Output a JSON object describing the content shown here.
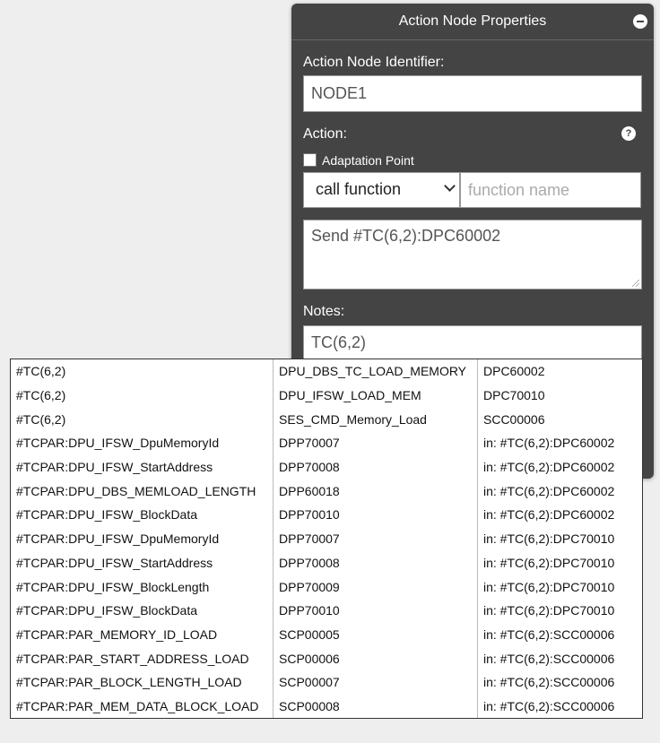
{
  "panel": {
    "title": "Action Node Properties",
    "identifier_label": "Action Node Identifier:",
    "identifier_value": "NODE1",
    "action_label": "Action:",
    "help_icon": "?",
    "adaptation_label": "Adaptation Point",
    "adaptation_checked": false,
    "select_value": "call function",
    "function_placeholder": "function name",
    "action_text": "Send #TC(6,2):DPC60002",
    "notes_label": "Notes:",
    "notes_value": "TC(6,2)"
  },
  "autocomplete": {
    "rows": [
      [
        "#TC(6,2)",
        "DPU_DBS_TC_LOAD_MEMORY",
        "DPC60002"
      ],
      [
        "#TC(6,2)",
        "DPU_IFSW_LOAD_MEM",
        "DPC70010"
      ],
      [
        "#TC(6,2)",
        "SES_CMD_Memory_Load",
        "SCC00006"
      ],
      [
        "#TCPAR:DPU_IFSW_DpuMemoryId",
        "DPP70007",
        "in: #TC(6,2):DPC60002"
      ],
      [
        "#TCPAR:DPU_IFSW_StartAddress",
        "DPP70008",
        "in: #TC(6,2):DPC60002"
      ],
      [
        "#TCPAR:DPU_DBS_MEMLOAD_LENGTH",
        "DPP60018",
        "in: #TC(6,2):DPC60002"
      ],
      [
        "#TCPAR:DPU_IFSW_BlockData",
        "DPP70010",
        "in: #TC(6,2):DPC60002"
      ],
      [
        "#TCPAR:DPU_IFSW_DpuMemoryId",
        "DPP70007",
        "in: #TC(6,2):DPC70010"
      ],
      [
        "#TCPAR:DPU_IFSW_StartAddress",
        "DPP70008",
        "in: #TC(6,2):DPC70010"
      ],
      [
        "#TCPAR:DPU_IFSW_BlockLength",
        "DPP70009",
        "in: #TC(6,2):DPC70010"
      ],
      [
        "#TCPAR:DPU_IFSW_BlockData",
        "DPP70010",
        "in: #TC(6,2):DPC70010"
      ],
      [
        "#TCPAR:PAR_MEMORY_ID_LOAD",
        "SCP00005",
        "in: #TC(6,2):SCC00006"
      ],
      [
        "#TCPAR:PAR_START_ADDRESS_LOAD",
        "SCP00006",
        "in: #TC(6,2):SCC00006"
      ],
      [
        "#TCPAR:PAR_BLOCK_LENGTH_LOAD",
        "SCP00007",
        "in: #TC(6,2):SCC00006"
      ],
      [
        "#TCPAR:PAR_MEM_DATA_BLOCK_LOAD",
        "SCP00008",
        "in: #TC(6,2):SCC00006"
      ]
    ]
  }
}
